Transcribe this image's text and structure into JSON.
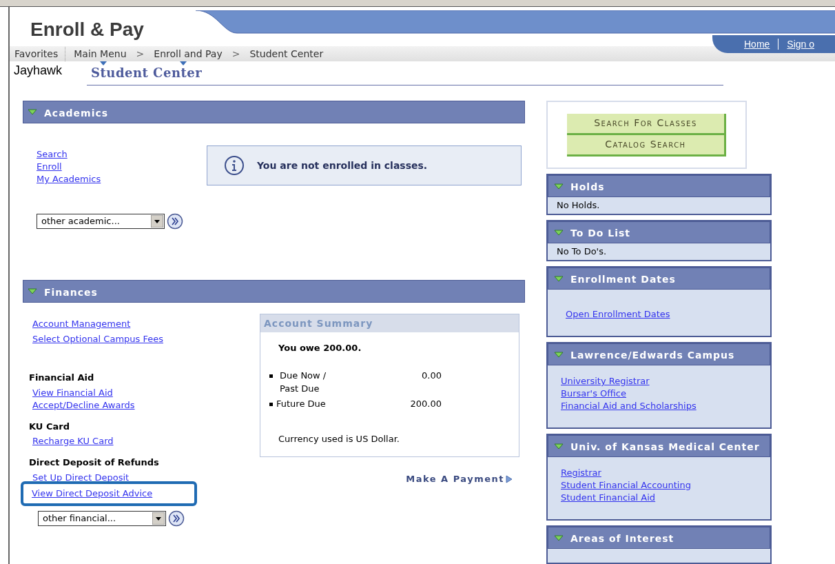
{
  "header": {
    "title": "Enroll & Pay",
    "nav_links": [
      "Home",
      "Sign o"
    ]
  },
  "breadcrumb": {
    "favorites": "Favorites",
    "separator": ">",
    "items": [
      {
        "label": "Main Menu",
        "menu": true
      },
      {
        "label": "Enroll and Pay",
        "menu": true
      },
      {
        "label": "Student Center",
        "menu": false
      }
    ]
  },
  "user": "Jayhawk",
  "page_title": "Student Center",
  "academics": {
    "title": "Academics",
    "links": [
      "Search",
      "Enroll",
      "My Academics"
    ],
    "notice": "You are not enrolled in classes.",
    "dropdown": "other academic..."
  },
  "finances": {
    "title": "Finances",
    "links": [
      "Account Management",
      "Select Optional Campus Fees"
    ],
    "groups": [
      {
        "heading": "Financial Aid",
        "links": [
          {
            "label": "View Financial Aid",
            "highlighted": false
          },
          {
            "label": "Accept/Decline Awards",
            "highlighted": false
          }
        ]
      },
      {
        "heading": "KU Card",
        "links": [
          {
            "label": "Recharge KU Card",
            "highlighted": false
          }
        ]
      },
      {
        "heading": "Direct Deposit of Refunds",
        "links": [
          {
            "label": "Set Up Direct Deposit",
            "highlighted": false
          },
          {
            "label": "View Direct Deposit Advice",
            "highlighted": true
          }
        ]
      }
    ],
    "summary": {
      "title": "Account Summary",
      "owe": "You owe 200.00.",
      "rows": [
        {
          "label": "Due Now / Past Due",
          "amount": "0.00"
        },
        {
          "label": "Future Due",
          "amount": "200.00"
        }
      ],
      "currency": "Currency used is US Dollar."
    },
    "payment": "Make A Payment",
    "dropdown": "other financial..."
  },
  "right": {
    "buttons": [
      "Search For Classes",
      "Catalog Search"
    ],
    "panels": [
      {
        "title": "Holds",
        "kind": "text",
        "body": "No Holds."
      },
      {
        "title": "To Do List",
        "kind": "text",
        "body": "No To Do's."
      },
      {
        "title": "Enrollment Dates",
        "kind": "links",
        "links": [
          "Open Enrollment Dates"
        ]
      },
      {
        "title": "Lawrence/Edwards Campus",
        "kind": "links",
        "links": [
          "University Registrar",
          "Bursar's Office",
          "Financial Aid and Scholarships"
        ]
      },
      {
        "title": "Univ. of Kansas Medical Center",
        "kind": "links",
        "links": [
          "Registrar",
          "Student Financial Accounting",
          "Student Financial Aid"
        ]
      },
      {
        "title": "Areas of Interest",
        "kind": "header"
      }
    ]
  }
}
